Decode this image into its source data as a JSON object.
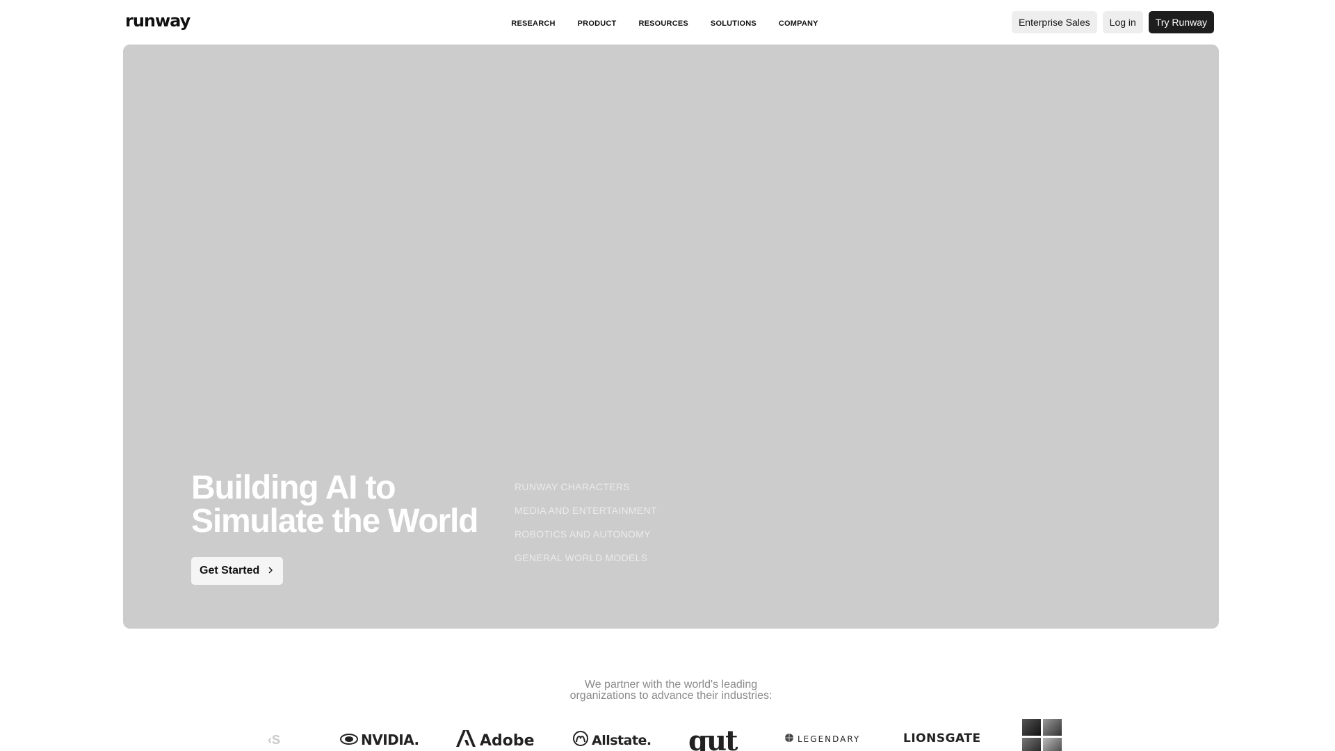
{
  "header": {
    "logo": "runway",
    "nav": [
      {
        "label": "RESEARCH"
      },
      {
        "label": "PRODUCT"
      },
      {
        "label": "RESOURCES"
      },
      {
        "label": "SOLUTIONS"
      },
      {
        "label": "COMPANY"
      }
    ],
    "actions": {
      "enterprise": "Enterprise Sales",
      "login": "Log in",
      "try": "Try Runway"
    }
  },
  "hero": {
    "title_line1": "Building AI to",
    "title_line2": "Simulate the World",
    "cta": "Get Started",
    "cta_icon": "chevron-right-icon",
    "list": [
      "RUNWAY CHARACTERS",
      "MEDIA AND ENTERTAINMENT",
      "ROBOTICS AND AUTONOMY",
      "GENERAL WORLD MODELS"
    ]
  },
  "partners": {
    "line1": "We partner with the world's leading",
    "line2": "organizations to advance their industries:",
    "logos": {
      "faded": "‹S",
      "nvidia": "NVIDIA.",
      "adobe": "Adobe",
      "allstate": "Allstate.",
      "gut": "gut",
      "legendary": "LEGENDARY",
      "lionsgate": "LIONSGATE"
    }
  },
  "colors": {
    "hero_bg": "#cccccc",
    "primary_button": "#1e1e1e",
    "light_button": "#eeeeee"
  }
}
